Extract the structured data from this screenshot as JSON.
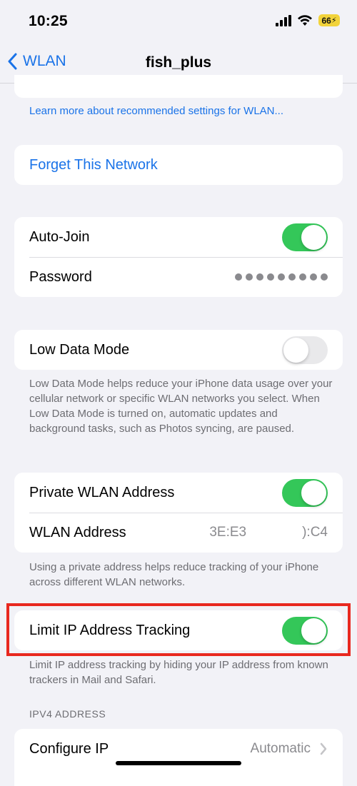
{
  "status_bar": {
    "time": "10:25",
    "battery": "66"
  },
  "nav": {
    "back_label": "WLAN",
    "title": "fish_plus"
  },
  "learn_more_link": "Learn more about recommended settings for WLAN...",
  "forget_network_label": "Forget This Network",
  "auto_join": {
    "label": "Auto-Join",
    "on": true
  },
  "password": {
    "label": "Password"
  },
  "low_data_mode": {
    "label": "Low Data Mode",
    "on": false,
    "description": "Low Data Mode helps reduce your iPhone data usage over your cellular network or specific WLAN networks you select. When Low Data Mode is turned on, automatic updates and background tasks, such as Photos syncing, are paused."
  },
  "private_address": {
    "label": "Private WLAN Address",
    "on": true,
    "address_label": "WLAN Address",
    "address_prefix": "3E:E3",
    "address_suffix": "):C4",
    "description": "Using a private address helps reduce tracking of your iPhone across different WLAN networks."
  },
  "limit_ip_tracking": {
    "label": "Limit IP Address Tracking",
    "on": true,
    "description": "Limit IP address tracking by hiding your IP address from known trackers in Mail and Safari."
  },
  "ipv4": {
    "header": "IPV4 ADDRESS",
    "configure_label": "Configure IP",
    "configure_value": "Automatic"
  },
  "colors": {
    "accent": "#1a73e8",
    "toggle_on": "#34c759",
    "highlight": "#e8281f"
  }
}
